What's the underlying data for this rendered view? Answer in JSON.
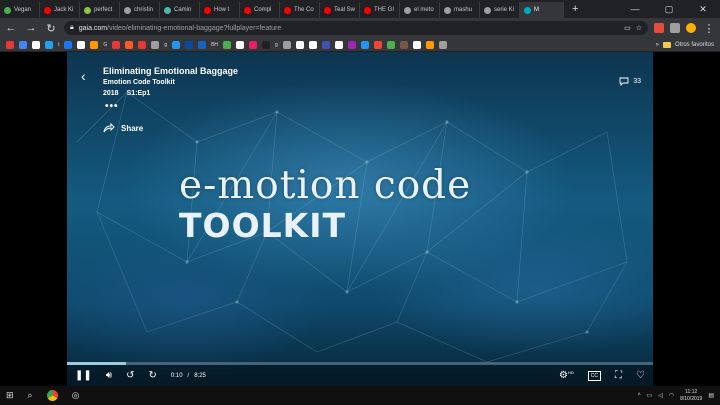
{
  "tabs": [
    {
      "label": "Vegan",
      "color": "#4caf50"
    },
    {
      "label": "Jack Ki",
      "color": "#ff0000"
    },
    {
      "label": "perfect",
      "color": "#8bc34a"
    },
    {
      "label": "christin",
      "color": "#9e9e9e"
    },
    {
      "label": "Camin",
      "color": "#4db6ac"
    },
    {
      "label": "How t",
      "color": "#ff0000"
    },
    {
      "label": "Compl",
      "color": "#ff0000"
    },
    {
      "label": "The Co",
      "color": "#ff0000"
    },
    {
      "label": "Teal Sw",
      "color": "#ff0000"
    },
    {
      "label": "THE GI",
      "color": "#ff0000"
    },
    {
      "label": "el meto",
      "color": "#9e9e9e"
    },
    {
      "label": "mashu",
      "color": "#9e9e9e"
    },
    {
      "label": "serie Ki",
      "color": "#9e9e9e"
    },
    {
      "label": "M",
      "color": "#00acc1",
      "active": true
    }
  ],
  "new_tab": "+",
  "window": {
    "minimize": "—",
    "maximize": "▢",
    "close": "✕"
  },
  "address": {
    "host": "gaia.com",
    "path": "/video/eliminating-emotional-baggage?fullplayer=feature"
  },
  "bookmarks": {
    "icons": [
      "#e53935",
      "#4285f4",
      "#ffffff",
      "#1da1f2",
      "#1877f2",
      "#ffffff",
      "#ff9800",
      "#e53935",
      "#ff5722",
      "#e53935",
      "#9e9e9e",
      "#2196f3",
      "#0d47a1",
      "#1565c0",
      "#4caf50",
      "#ffffff",
      "#e91e63",
      "#212121",
      "#9e9e9e",
      "#ffffff",
      "#ffffff",
      "#3f51b5",
      "#ffffff",
      "#9c27b0",
      "#2196f3",
      "#f44336",
      "#4caf50",
      "#795548",
      "#ffffff",
      "#ff9800",
      "#9e9e9e"
    ],
    "texts": [
      "t",
      "G",
      "g",
      "BH",
      "g"
    ],
    "more": "»",
    "folder_label": "Otros favoritos"
  },
  "player": {
    "episode_title": "Eliminating Emotional Baggage",
    "series": "Emotion Code Toolkit",
    "year": "2018",
    "episode": "S1:Ep1",
    "more": "•••",
    "share": "Share",
    "comments": "33",
    "headline": "e-motion code",
    "subheadline": "TOOLKIT",
    "time_current": "0:10",
    "time_sep": "/",
    "time_total": "8:25",
    "progress": 0.1,
    "hd": "HD",
    "cc": "CC"
  },
  "taskbar": {
    "time": "11:12",
    "date": "8/10/2019"
  }
}
